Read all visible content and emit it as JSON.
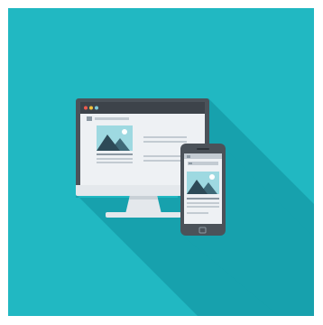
{
  "illustration": {
    "subject": "responsive-web-design-icon",
    "devices": [
      "desktop-monitor",
      "smartphone"
    ],
    "colors": {
      "background": "#21b8c2",
      "long_shadow": "#17a1ad",
      "monitor_frame": "#4b5259",
      "monitor_stand": "#e4e8ec",
      "stand_shade": "#c9d0d6",
      "browser_bar": "#3d434a",
      "screen": "#eef1f4",
      "image_bg": "#9ed9e1",
      "mountain": "#2d4a57",
      "mountain_light": "#3f6a78",
      "sun": "#ffffff",
      "text_line": "#c3cbd2",
      "text_dark": "#8d99a3",
      "dot_red": "#ef5b50",
      "dot_yellow": "#f4c13c",
      "dot_green": "#7fc8d8",
      "phone_body": "#4b5259"
    }
  }
}
